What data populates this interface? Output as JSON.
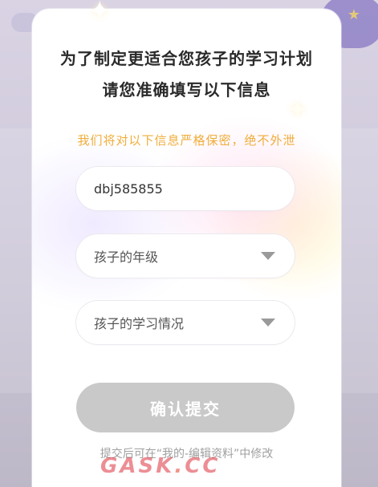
{
  "modal": {
    "title_line1": "为了制定更适合您孩子的学习计划",
    "title_line2": "请您准确填写以下信息",
    "privacy_note": "我们将对以下信息严格保密，绝不外泄",
    "fields": {
      "account_value": "dbj585855",
      "grade_placeholder": "孩子的年级",
      "study_status_placeholder": "孩子的学习情况"
    },
    "submit_label": "确认提交",
    "edit_hint": "提交后可在“我的-编辑资料”中修改"
  },
  "watermark": {
    "text_main": "GASK",
    "text_dot": ".",
    "text_tld": "CC"
  },
  "colors": {
    "privacy_text": "#f0ad3a",
    "submit_disabled": "#c9c9c9",
    "hint_text": "#a0a0a0"
  }
}
